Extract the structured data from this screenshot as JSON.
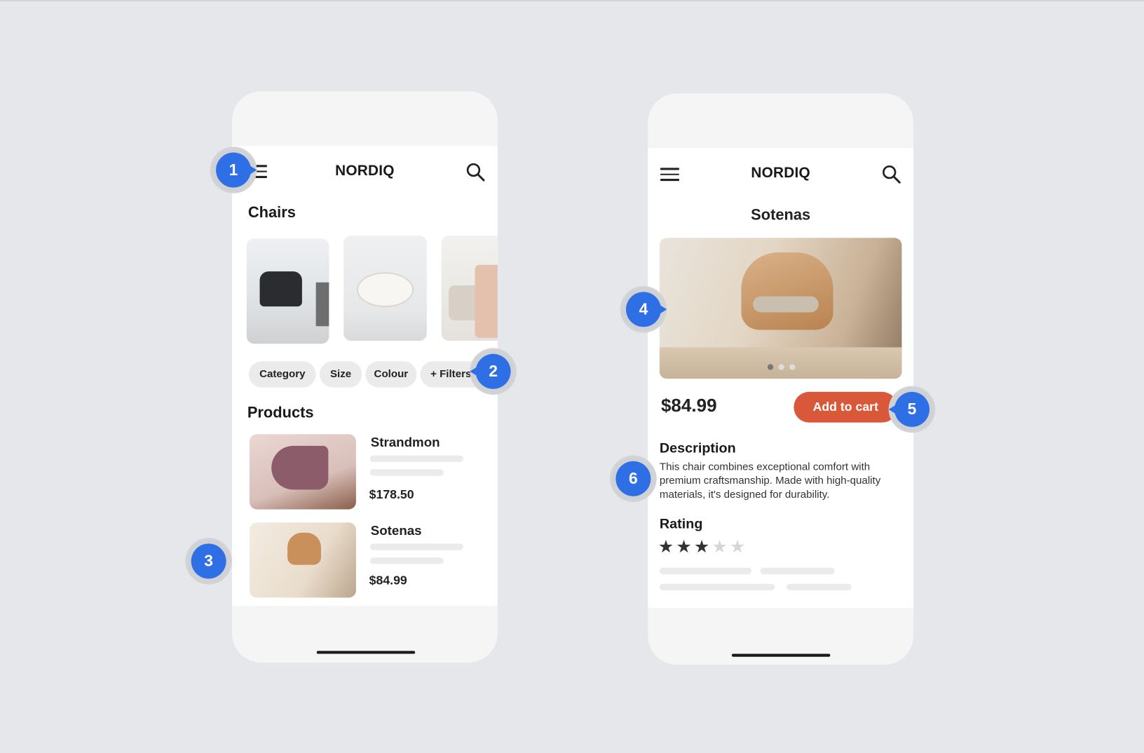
{
  "colors": {
    "accent": "#d9583a",
    "callout": "#2f6fe6",
    "star_filled": "#333333",
    "star_empty": "#d6d6d6"
  },
  "list_screen": {
    "brand": "NORDIQ",
    "menu_icon": "hamburger-icon",
    "search_icon": "search-icon",
    "category_title": "Chairs",
    "filters": [
      "Category",
      "Size",
      "Colour",
      "+ Filters"
    ],
    "products_title": "Products",
    "products": [
      {
        "name": "Strandmon",
        "price": "$178.50"
      },
      {
        "name": "Sotenas",
        "price": "$84.99"
      }
    ]
  },
  "detail_screen": {
    "brand": "NORDIQ",
    "title": "Sotenas",
    "price": "$84.99",
    "add_to_cart": "Add to cart",
    "description_title": "Description",
    "description": "This chair combines exceptional comfort with premium craftsmanship. Made with high-quality materials, it's designed for durability.",
    "rating_title": "Rating",
    "rating": 3,
    "rating_max": 5,
    "carousel_pages": 3,
    "carousel_active": 1
  },
  "callouts": [
    "1",
    "2",
    "3",
    "4",
    "5",
    "6"
  ]
}
